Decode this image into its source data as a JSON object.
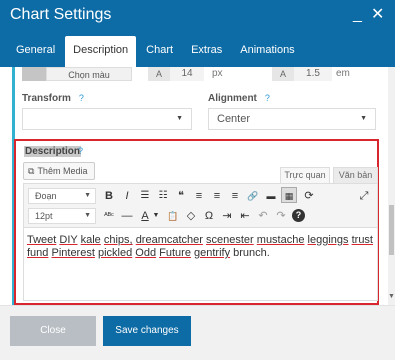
{
  "window": {
    "title": "Chart Settings",
    "minimize_glyph": "_",
    "close_glyph": "✕"
  },
  "tabs": [
    {
      "label": "General"
    },
    {
      "label": "Description",
      "active": true
    },
    {
      "label": "Chart"
    },
    {
      "label": "Extras"
    },
    {
      "label": "Animations"
    }
  ],
  "color_row": {
    "pick_label": "Chọn màu",
    "a_label_1": "A",
    "size_value": "14",
    "size_unit": "px",
    "a_label_2": "A",
    "line_height_value": "1.5",
    "line_height_unit": "em"
  },
  "transform": {
    "label": "Transform",
    "help": "?",
    "value": ""
  },
  "alignment": {
    "label": "Alignment",
    "help": "?",
    "value": "Center"
  },
  "description": {
    "label": "Description",
    "help": "?",
    "add_media_label": "Thêm Media",
    "visual_tab": "Trực quan",
    "text_tab": "Văn bản",
    "paragraph_select": "Đoạn",
    "size_select": "12pt",
    "content_words": [
      "Tweet",
      "DIY",
      "kale",
      "chips,",
      "dreamcatcher",
      "scenester",
      "mustache",
      "leggings",
      "trust",
      "fund",
      "Pinterest",
      "pickled",
      "Odd",
      "Future",
      "gentrify",
      "brunch."
    ]
  },
  "toolbar_row1": [
    "B",
    "I",
    "☰",
    "☷",
    "❝",
    "≡",
    "≡",
    "≡",
    "🔗",
    "▬",
    "▦",
    "⟳",
    "⤢"
  ],
  "toolbar_row2": [
    "ᴬᴮᶜ",
    "—",
    "A",
    "📋",
    "◇",
    "Ω",
    "⇥",
    "⇤",
    "↶",
    "↷",
    "?"
  ],
  "footer": {
    "close_label": "Close",
    "save_label": "Save changes"
  },
  "colors": {
    "header": "#0d6ba5",
    "accent": "#32b0cf",
    "highlight_border": "#d7262e",
    "close_button": "#b9bec4"
  },
  "icons": {
    "minimize": "minimize-icon",
    "close": "close-icon",
    "media": "add-media-icon"
  }
}
